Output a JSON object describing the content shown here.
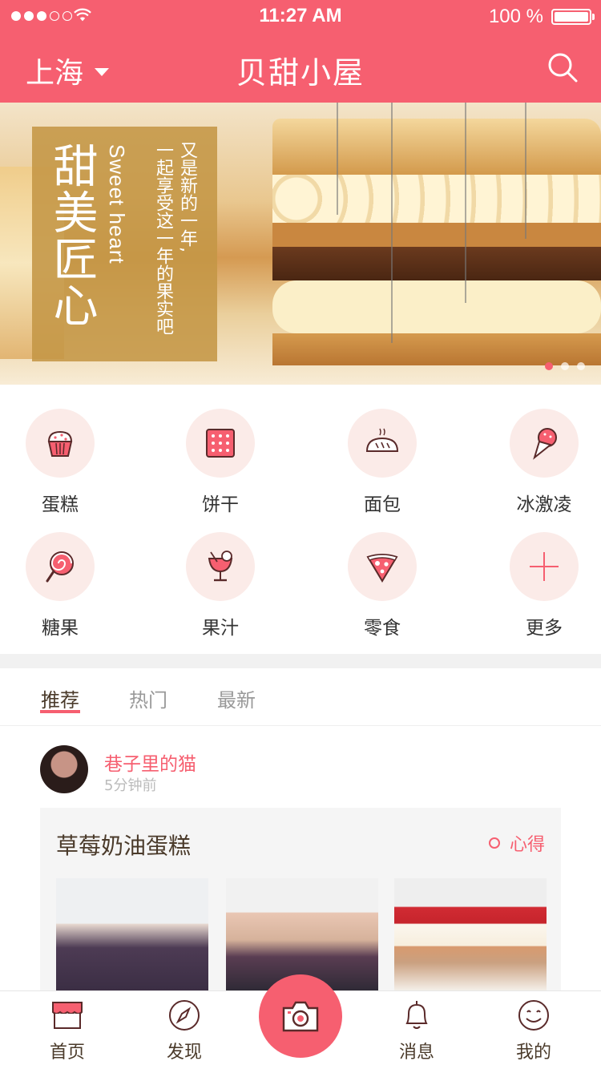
{
  "status_bar": {
    "time": "11:27 AM",
    "battery": "100 %"
  },
  "header": {
    "city": "上海",
    "title": "贝甜小屋"
  },
  "banner": {
    "title_cn": "甜美匠心",
    "title_en": "Sweet heart",
    "line1": "又是新的一年,",
    "line2": "一起享受这一年的果实吧"
  },
  "categories": [
    {
      "label": "蛋糕",
      "icon": "cupcake-icon"
    },
    {
      "label": "饼干",
      "icon": "biscuit-icon"
    },
    {
      "label": "面包",
      "icon": "bread-icon"
    },
    {
      "label": "冰激凌",
      "icon": "ice-cream-icon"
    },
    {
      "label": "糖果",
      "icon": "lollipop-icon"
    },
    {
      "label": "果汁",
      "icon": "juice-icon"
    },
    {
      "label": "零食",
      "icon": "pizza-icon"
    },
    {
      "label": "更多",
      "icon": "plus-icon"
    }
  ],
  "tabs": [
    {
      "label": "推荐",
      "active": true
    },
    {
      "label": "热门",
      "active": false
    },
    {
      "label": "最新",
      "active": false
    }
  ],
  "post": {
    "author": "巷子里的猫",
    "time_ago": "5分钟前",
    "title": "草莓奶油蛋糕",
    "tag": "心得"
  },
  "bottom_nav": [
    {
      "label": "首页",
      "icon": "shop-icon"
    },
    {
      "label": "发现",
      "icon": "compass-icon"
    },
    {
      "label": "",
      "icon": "camera-icon"
    },
    {
      "label": "消息",
      "icon": "bell-icon"
    },
    {
      "label": "我的",
      "icon": "smiley-icon"
    }
  ],
  "colors": {
    "accent": "#f65f70",
    "icon_bg": "#fbebe8",
    "text_dark": "#4a3a2a"
  }
}
